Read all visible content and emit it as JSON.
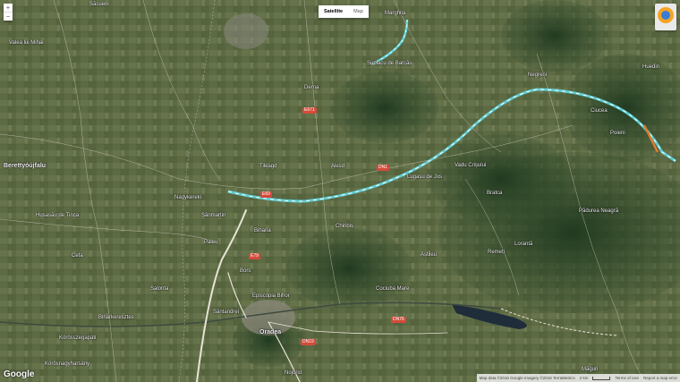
{
  "map_type": {
    "satellite_label": "Satellite",
    "map_label": "Map",
    "active": "Satellite"
  },
  "zoom": {
    "in_label": "+",
    "out_label": "−"
  },
  "brand": {
    "logo_text": "Google"
  },
  "attribution": {
    "data_text": "Map data ©2016 Google Imagery ©2016 TerraMetrics",
    "scale_text": "2 km",
    "terms_text": "Terms of Use",
    "report_text": "Report a map error"
  },
  "route": {
    "color": "#5fd6e0"
  },
  "places": [
    {
      "name": "Berettyóújfalu",
      "big": true
    },
    {
      "name": "Nagykereki"
    },
    {
      "name": "Bors"
    },
    {
      "name": "Oradea",
      "big": true
    },
    {
      "name": "Episcopia Bihor"
    },
    {
      "name": "Sântandrei"
    },
    {
      "name": "Biharia"
    },
    {
      "name": "Nojorid"
    },
    {
      "name": "Paleu"
    },
    {
      "name": "Sânmartin"
    },
    {
      "name": "Tileagd"
    },
    {
      "name": "Aleșd"
    },
    {
      "name": "Suplacu de Barcău"
    },
    {
      "name": "Chiribiș"
    },
    {
      "name": "Lugașu de Jos"
    },
    {
      "name": "Vadu Crișului"
    },
    {
      "name": "Bratca"
    },
    {
      "name": "Negreni"
    },
    {
      "name": "Poieni"
    },
    {
      "name": "Ciucea"
    },
    {
      "name": "Huedin"
    },
    {
      "name": "Măguri"
    },
    {
      "name": "Săcueni"
    },
    {
      "name": "Valea lui Mihai"
    },
    {
      "name": "Marghita"
    },
    {
      "name": "Cefa"
    },
    {
      "name": "Salonta"
    },
    {
      "name": "Derna"
    },
    {
      "name": "Cociuba Mare"
    },
    {
      "name": "Biharkeresztes"
    },
    {
      "name": "Körösszegapáti"
    },
    {
      "name": "Körösnagyharsány"
    },
    {
      "name": "Pădurea Neagră"
    },
    {
      "name": "Lorantă"
    },
    {
      "name": "Remeți"
    },
    {
      "name": "Aștileu"
    },
    {
      "name": "Husasău de Tinca"
    }
  ],
  "shields": [
    "E60",
    "DN1",
    "E671",
    "E79",
    "DN76",
    "DN19"
  ],
  "icons": {
    "zoom_in": "plus-icon",
    "zoom_out": "minus-icon",
    "street_view": "pegman-icon"
  }
}
